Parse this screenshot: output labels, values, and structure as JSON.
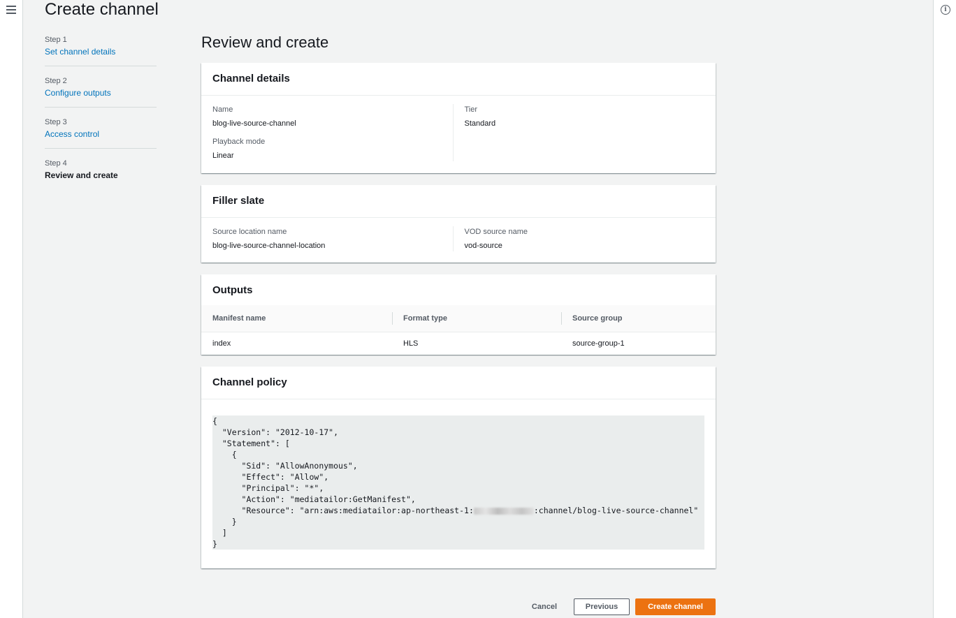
{
  "page": {
    "title": "Create channel"
  },
  "steps": [
    {
      "num": "Step 1",
      "label": "Set channel details"
    },
    {
      "num": "Step 2",
      "label": "Configure outputs"
    },
    {
      "num": "Step 3",
      "label": "Access control"
    },
    {
      "num": "Step 4",
      "label": "Review and create"
    }
  ],
  "review": {
    "title": "Review and create",
    "channel_details": {
      "title": "Channel details",
      "name_label": "Name",
      "name_value": "blog-live-source-channel",
      "playback_label": "Playback mode",
      "playback_value": "Linear",
      "tier_label": "Tier",
      "tier_value": "Standard"
    },
    "filler_slate": {
      "title": "Filler slate",
      "source_location_label": "Source location name",
      "source_location_value": "blog-live-source-channel-location",
      "vod_source_label": "VOD source name",
      "vod_source_value": "vod-source"
    },
    "outputs": {
      "title": "Outputs",
      "columns": [
        "Manifest name",
        "Format type",
        "Source group"
      ],
      "rows": [
        [
          "index",
          "HLS",
          "source-group-1"
        ]
      ]
    },
    "policy": {
      "title": "Channel policy",
      "code_before_redaction": "{\n  \"Version\": \"2012-10-17\",\n  \"Statement\": [\n    {\n      \"Sid\": \"AllowAnonymous\",\n      \"Effect\": \"Allow\",\n      \"Principal\": \"*\",\n      \"Action\": \"mediatailor:GetManifest\",\n      \"Resource\": \"arn:aws:mediatailor:ap-northeast-1:",
      "code_after_redaction": ":channel/blog-live-source-channel\"\n    }\n  ]\n}"
    }
  },
  "actions": {
    "cancel": "Cancel",
    "previous": "Previous",
    "create": "Create channel"
  },
  "icons": {
    "menu": "hamburger-menu-icon",
    "info": "info-icon"
  },
  "colors": {
    "link": "#0073bb",
    "primary": "#ec7211"
  }
}
